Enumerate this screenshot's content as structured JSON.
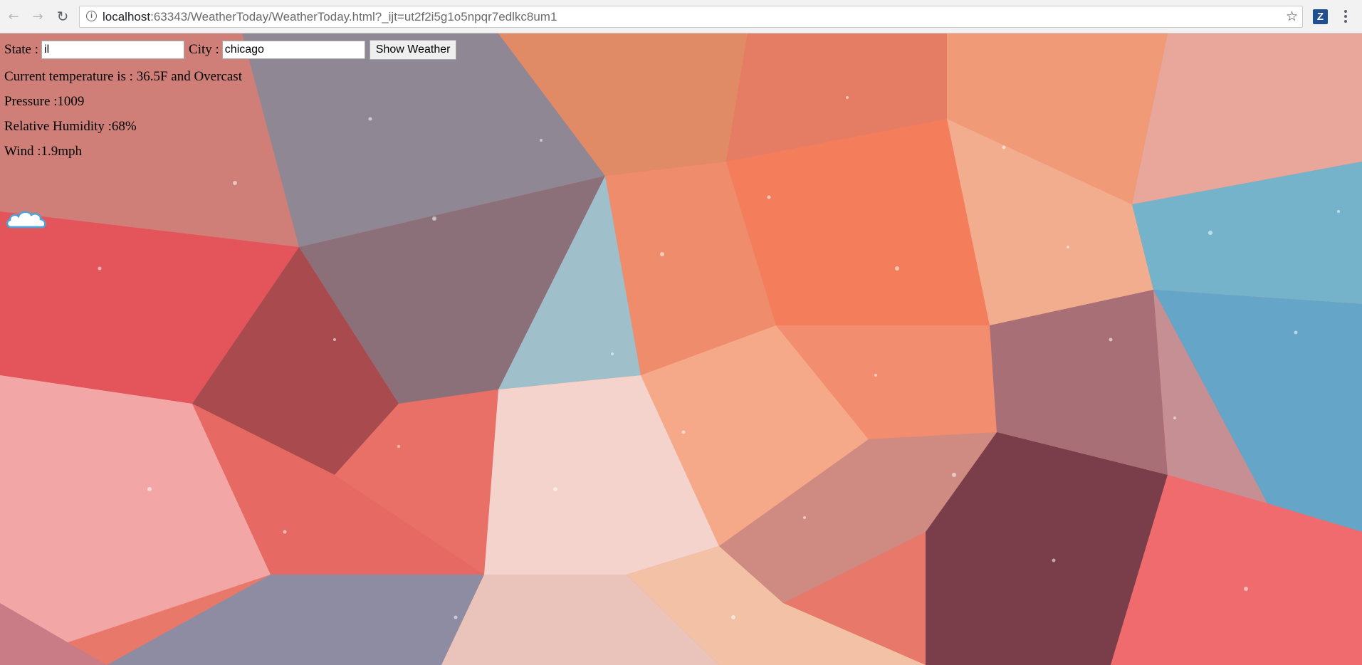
{
  "browser": {
    "url_host": "localhost",
    "url_rest": ":63343/WeatherToday/WeatherToday.html?_ijt=ut2f2i5g1o5npqr7edlkc8um1",
    "back_icon": "arrow-left-icon",
    "forward_icon": "arrow-right-icon",
    "reload_icon": "reload-icon",
    "extension_label": "Z"
  },
  "form": {
    "state_label": "State :",
    "state_value": "il",
    "city_label": "City :",
    "city_value": "chicago",
    "submit_label": "Show Weather"
  },
  "weather": {
    "temperature_line": "Current temperature is : 36.5F and Overcast",
    "pressure_line": "Pressure :1009",
    "humidity_line": "Relative Humidity :68%",
    "wind_line": "Wind :1.9mph",
    "condition_icon": "cloud-icon"
  }
}
